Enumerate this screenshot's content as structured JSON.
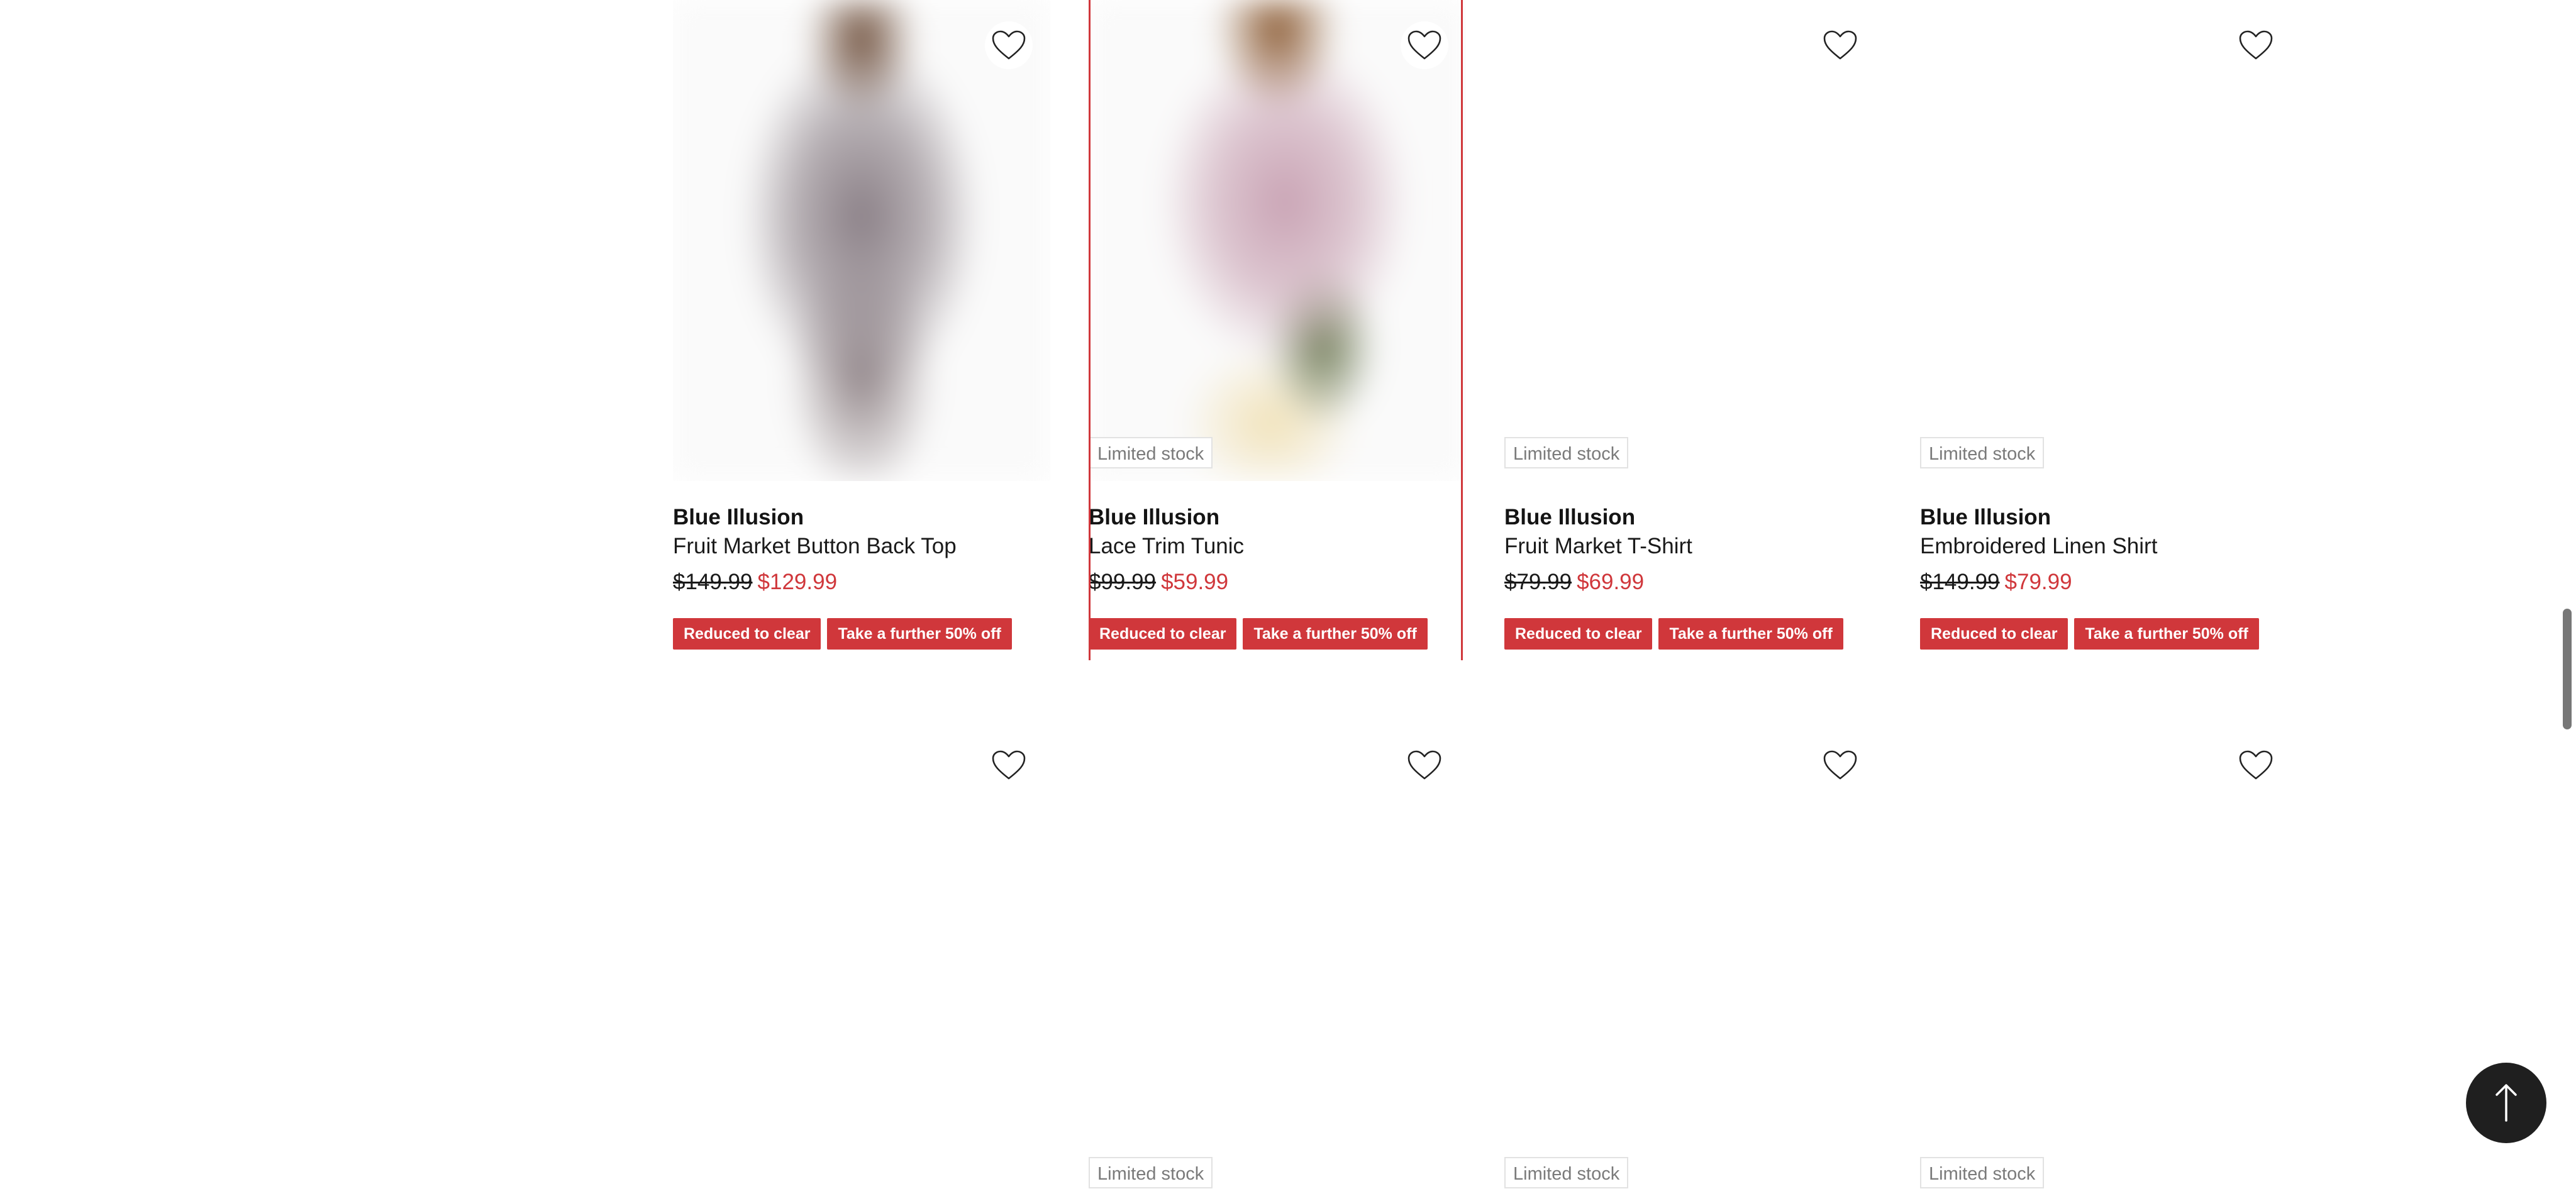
{
  "accent_color": "#d0373b",
  "products_row1": [
    {
      "brand": "Blue Illusion",
      "name": "Fruit Market Button Back Top",
      "was": "$149.99",
      "now": "$129.99",
      "badge": "",
      "tag1": "Reduced to clear",
      "tag2": "Take a further 50% off"
    },
    {
      "brand": "Blue Illusion",
      "name": "Lace Trim Tunic",
      "was": "$99.99",
      "now": "$59.99",
      "badge": "Limited stock",
      "tag1": "Reduced to clear",
      "tag2": "Take a further 50% off"
    },
    {
      "brand": "Blue Illusion",
      "name": "Fruit Market T-Shirt",
      "was": "$79.99",
      "now": "$69.99",
      "badge": "Limited stock",
      "tag1": "Reduced to clear",
      "tag2": "Take a further 50% off"
    },
    {
      "brand": "Blue Illusion",
      "name": "Embroidered Linen Shirt",
      "was": "$149.99",
      "now": "$79.99",
      "badge": "Limited stock",
      "tag1": "Reduced to clear",
      "tag2": "Take a further 50% off"
    }
  ],
  "products_row2": [
    {
      "badge": ""
    },
    {
      "badge": "Limited stock"
    },
    {
      "badge": "Limited stock"
    },
    {
      "badge": "Limited stock"
    }
  ],
  "icons": {
    "favorite": "heart-icon",
    "back_to_top": "arrow-up-icon"
  }
}
